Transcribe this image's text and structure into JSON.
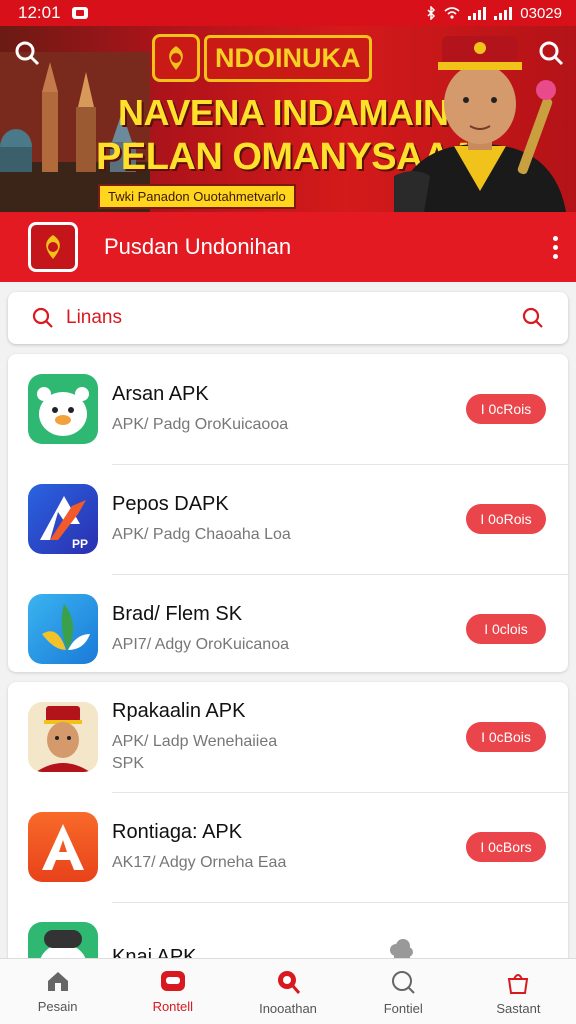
{
  "status_bar": {
    "time": "12:01",
    "right_text": "03029"
  },
  "banner": {
    "brand": "NDOINUKA",
    "headline_line1": "NAVENA INDAMAIN",
    "headline_line2": "PELAN OMANYSAAA",
    "tagline": "Twki Panadon Ouotahmetvarlo"
  },
  "appbar": {
    "title": "Pusdan Undonihan"
  },
  "search": {
    "placeholder": "Linans"
  },
  "apps_group1": [
    {
      "name": "Arsan APK",
      "subtitle": "APK/ Padg OroKuicaooa",
      "button": "I 0cRois",
      "icon": "bear-icon"
    },
    {
      "name": "Pepos DAPK",
      "subtitle": "APK/ Padg Chaoaha Loa",
      "button": "I 0oRois",
      "icon": "arrow-logo-icon"
    },
    {
      "name": "Brad/ Flem SK",
      "subtitle": "API7/ Adgy OroKuicanoa",
      "button": "I 0clois",
      "icon": "leaf-logo-icon"
    }
  ],
  "apps_group2": [
    {
      "name": "Rpakaalin APK",
      "subtitle": "APK/ Ladp Wenehaiiea SPK",
      "button": "I 0cBois",
      "icon": "person-avatar-icon"
    },
    {
      "name": "Rontiaga: APK",
      "subtitle": "AK17/ Adgy Orneha Eaa",
      "button": "I 0cBors",
      "icon": "letter-a-icon"
    },
    {
      "name": "Knai APK",
      "subtitle": "",
      "button": "",
      "icon": "mascot-icon"
    }
  ],
  "bottom_nav": [
    {
      "label": "Pesain",
      "icon": "home-icon",
      "active": false
    },
    {
      "label": "Rontell",
      "icon": "card-icon",
      "active": true
    },
    {
      "label": "Inooathan",
      "icon": "map-pin-icon",
      "active": false
    },
    {
      "label": "Fontiel",
      "icon": "search-icon",
      "active": false
    },
    {
      "label": "Sastant",
      "icon": "bag-icon",
      "active": false
    }
  ],
  "colors": {
    "primary": "#e31a22",
    "accent_yellow": "#ffe02a",
    "button": "#e9454b"
  }
}
